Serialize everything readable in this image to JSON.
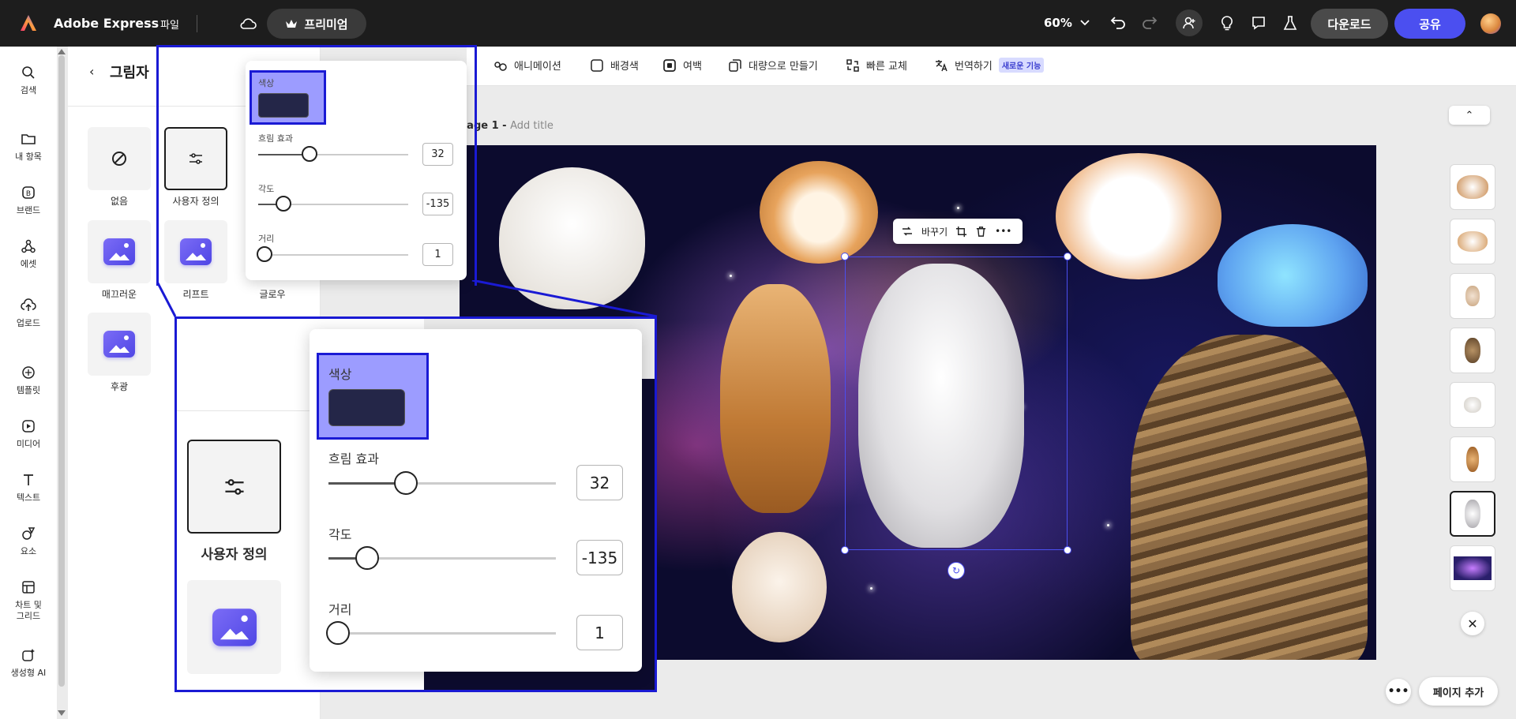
{
  "app": {
    "name": "Adobe Express",
    "file_menu": "파일",
    "premium": "프리미엄",
    "zoom": "60%",
    "download": "다운로드",
    "share": "공유"
  },
  "rail": {
    "items": [
      {
        "label": "검색",
        "icon": "search-icon"
      },
      {
        "label": "내 항목",
        "icon": "folder-icon"
      },
      {
        "label": "브랜드",
        "icon": "brand-icon"
      },
      {
        "label": "에셋",
        "icon": "assets-icon"
      },
      {
        "label": "업로드",
        "icon": "upload-icon"
      },
      {
        "label": "템플릿",
        "icon": "template-icon"
      },
      {
        "label": "미디어",
        "icon": "media-icon"
      },
      {
        "label": "텍스트",
        "icon": "text-icon"
      },
      {
        "label": "요소",
        "icon": "elements-icon"
      },
      {
        "label": "차트 및\n그리드",
        "icon": "chart-icon"
      },
      {
        "label": "생성형 AI",
        "icon": "ai-icon"
      }
    ]
  },
  "panel": {
    "title": "그림자",
    "tiles": [
      {
        "label": "없음"
      },
      {
        "label": "사용자 정의"
      },
      {
        "label": "매끄러운"
      },
      {
        "label": "리프트"
      },
      {
        "label": "글로우"
      },
      {
        "label": "후광"
      }
    ]
  },
  "shadow_popover": {
    "color_label": "색상",
    "color_value": "#242648",
    "blur_label": "흐림 효과",
    "blur_value": "32",
    "blur_fraction": 0.34,
    "angle_label": "각도",
    "angle_value": "-135",
    "angle_fraction": 0.17,
    "distance_label": "거리",
    "distance_value": "1",
    "distance_fraction": 0.04
  },
  "toolbar": [
    {
      "label": "애니메이션",
      "icon": "animation-icon"
    },
    {
      "label": "배경색",
      "icon": "checkbox-icon"
    },
    {
      "label": "여백",
      "icon": "padding-icon"
    },
    {
      "label": "대량으로 만들기",
      "icon": "bulk-create-icon"
    },
    {
      "label": "빠른 교체",
      "icon": "quick-swap-icon"
    },
    {
      "label": "번역하기",
      "icon": "translate-icon",
      "badge": "새로운 기능"
    }
  ],
  "canvas": {
    "page_label": "Page 1 -",
    "page_title_placeholder": "Add title",
    "context_bar": {
      "replace": "바꾸기"
    }
  },
  "bottom": {
    "add_page": "페이지 추가"
  }
}
